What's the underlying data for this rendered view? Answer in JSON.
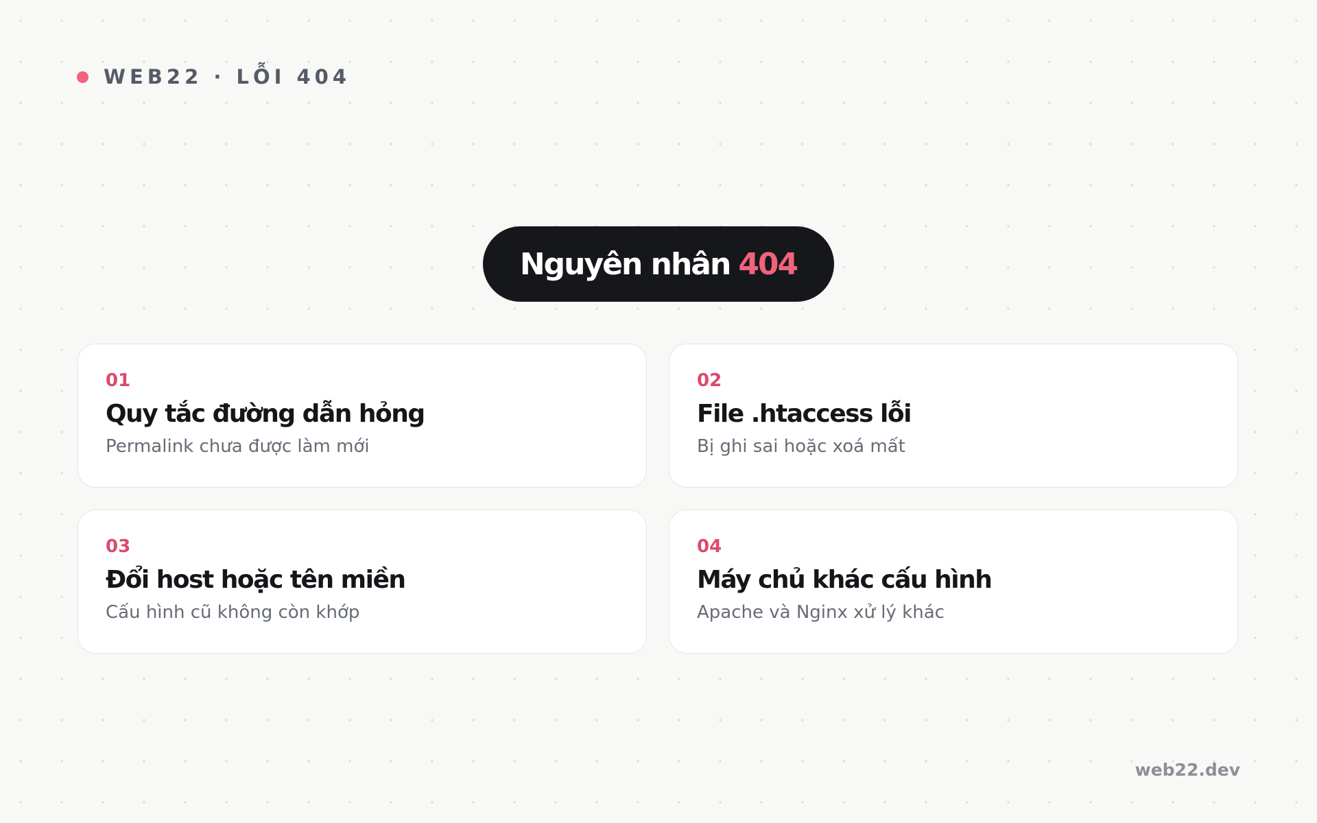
{
  "brand": {
    "label": "WEB22 · LỖI 404"
  },
  "heading": {
    "text": "Nguyên nhân",
    "accent": "404"
  },
  "cards": [
    {
      "number": "01",
      "title": "Quy tắc đường dẫn hỏng",
      "subtitle": "Permalink chưa được làm mới"
    },
    {
      "number": "02",
      "title": "File .htaccess lỗi",
      "subtitle": "Bị ghi sai hoặc xoá mất"
    },
    {
      "number": "03",
      "title": "Đổi host hoặc tên miền",
      "subtitle": "Cấu hình cũ không còn khớp"
    },
    {
      "number": "04",
      "title": "Máy chủ khác cấu hình",
      "subtitle": "Apache và Nginx xử lý khác"
    }
  ],
  "footer": {
    "site": "web22.dev"
  },
  "colors": {
    "accent": "#f0637c",
    "number": "#dc4a6b",
    "pill_background": "#16171b",
    "page_background": "#f8f8f7"
  }
}
